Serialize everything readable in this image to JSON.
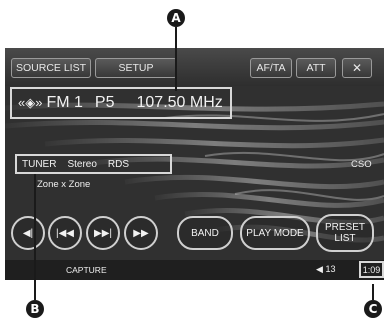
{
  "callouts": {
    "a": "A",
    "b": "B",
    "c": "C"
  },
  "topbar": {
    "source_list": "SOURCE LIST",
    "setup": "SETUP",
    "afta": "AF/TA",
    "att": "ATT",
    "close_symbol": "✕"
  },
  "tuner": {
    "logo_symbol": "«◈»",
    "band": "FM 1",
    "preset": "P5",
    "frequency": "107.50 MHz"
  },
  "info": {
    "source": "TUNER",
    "stereo": "Stereo",
    "rds": "RDS",
    "station_name": "Zone x Zone",
    "cso": "CSO"
  },
  "controls": {
    "seek_back": "◀|",
    "prev": "|◀◀",
    "next": "▶▶|",
    "fast_forward": "▶▶",
    "band_label": "BAND",
    "play_mode_label": "PLAY MODE",
    "preset_list_label": "PRESET\nLIST"
  },
  "statusbar": {
    "capture": "CAPTURE",
    "volume_icon": "◀",
    "volume": "13",
    "clock": "1:09"
  },
  "colors": {
    "screen_bg": "#2e2e2e",
    "highlight_border": "#d8d8d8",
    "text": "#f0f0f0",
    "callout": "#1a1a1a"
  }
}
